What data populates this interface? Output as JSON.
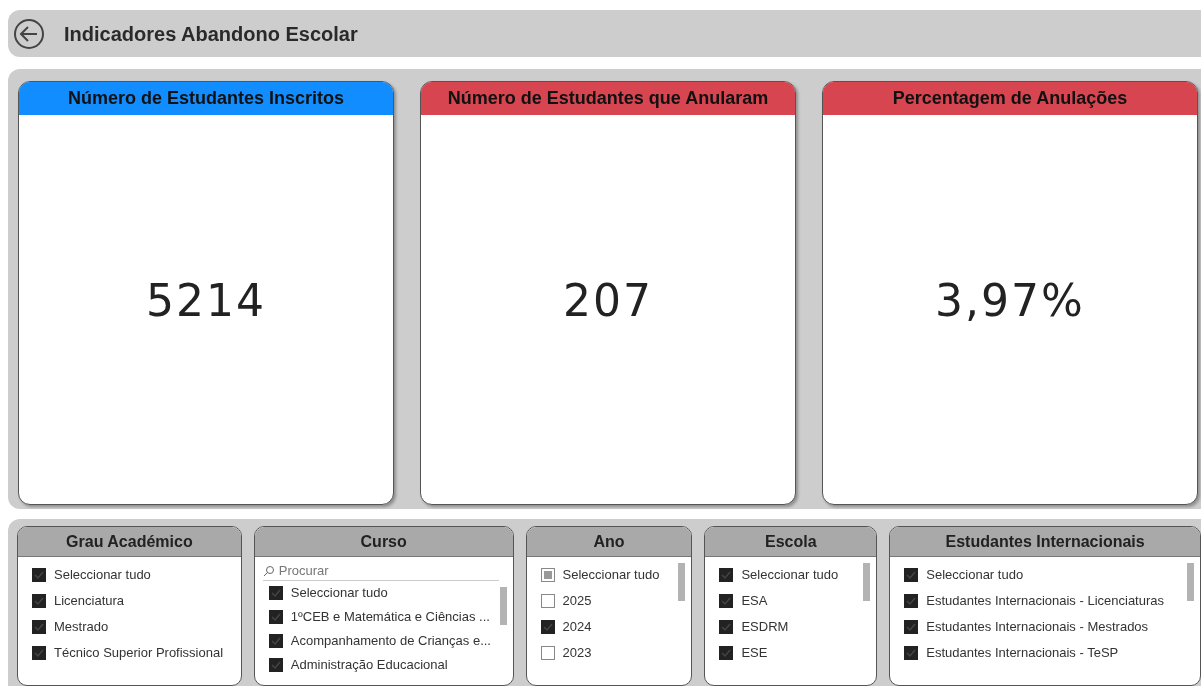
{
  "header": {
    "title": "Indicadores Abandono Escolar"
  },
  "cards": [
    {
      "title": "Número de Estudantes Inscritos",
      "value": "5214",
      "color": "#118dff"
    },
    {
      "title": "Número de Estudantes que Anularam",
      "value": "207",
      "color": "#d64550"
    },
    {
      "title": "Percentagem de Anulações",
      "value": "3,97%",
      "color": "#d64550"
    }
  ],
  "slicers": [
    {
      "title": "Grau Académico",
      "scrollbar": false,
      "items": [
        {
          "label": "Seleccionar tudo",
          "checked": true
        },
        {
          "label": "Licenciatura",
          "checked": true
        },
        {
          "label": "Mestrado",
          "checked": true
        },
        {
          "label": "Técnico Superior Profissional",
          "checked": true
        }
      ]
    },
    {
      "title": "Curso",
      "scrollbar": true,
      "search": {
        "placeholder": "Procurar"
      },
      "items": [
        {
          "label": "Seleccionar tudo",
          "checked": true
        },
        {
          "label": "1ºCEB e Matemática e Ciências ...",
          "checked": true
        },
        {
          "label": "Acompanhamento de Crianças e...",
          "checked": true
        },
        {
          "label": "Administração Educacional",
          "checked": true
        }
      ]
    },
    {
      "title": "Ano",
      "scrollbar": true,
      "items": [
        {
          "label": "Seleccionar tudo",
          "checked": false,
          "indeterminate": true
        },
        {
          "label": "2025",
          "checked": false,
          "indeterminate": false
        },
        {
          "label": "2024",
          "checked": true,
          "indeterminate": false
        },
        {
          "label": "2023",
          "checked": false,
          "indeterminate": false
        }
      ]
    },
    {
      "title": "Escola",
      "scrollbar": true,
      "items": [
        {
          "label": "Seleccionar tudo",
          "checked": true
        },
        {
          "label": "ESA",
          "checked": true
        },
        {
          "label": "ESDRM",
          "checked": true
        },
        {
          "label": "ESE",
          "checked": true
        }
      ]
    },
    {
      "title": "Estudantes Internacionais",
      "scrollbar": true,
      "items": [
        {
          "label": "Seleccionar tudo",
          "checked": true
        },
        {
          "label": "Estudantes Internacionais - Licenciaturas",
          "checked": true
        },
        {
          "label": "Estudantes Internacionais - Mestrados",
          "checked": true
        },
        {
          "label": "Estudantes Internacionais - TeSP",
          "checked": true
        }
      ]
    }
  ]
}
